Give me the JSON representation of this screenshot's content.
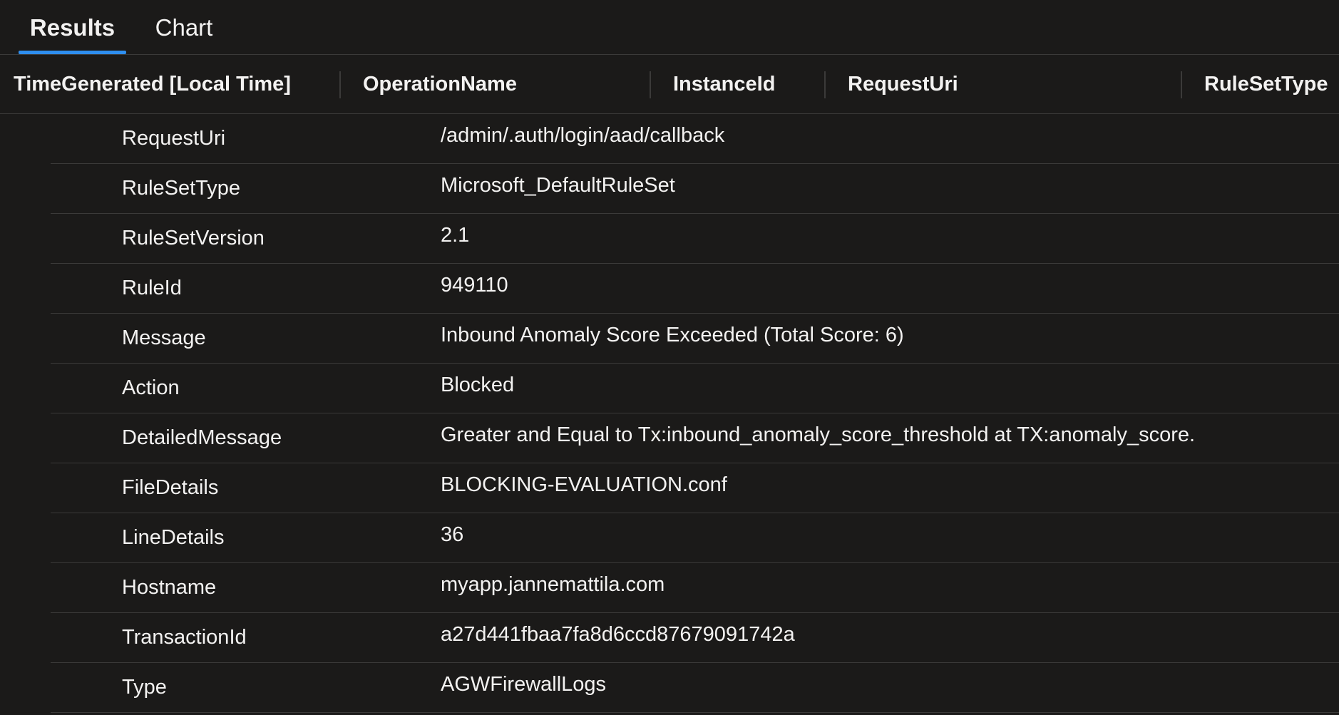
{
  "tabs": [
    {
      "label": "Results"
    },
    {
      "label": "Chart"
    }
  ],
  "columns": [
    {
      "label": "TimeGenerated [Local Time]"
    },
    {
      "label": "OperationName"
    },
    {
      "label": "InstanceId"
    },
    {
      "label": "RequestUri"
    },
    {
      "label": "RuleSetType"
    }
  ],
  "details": [
    {
      "key": "RequestUri",
      "value": "/admin/.auth/login/aad/callback"
    },
    {
      "key": "RuleSetType",
      "value": "Microsoft_DefaultRuleSet"
    },
    {
      "key": "RuleSetVersion",
      "value": "2.1"
    },
    {
      "key": "RuleId",
      "value": "949110"
    },
    {
      "key": "Message",
      "value": "Inbound Anomaly Score Exceeded (Total Score: 6)"
    },
    {
      "key": "Action",
      "value": "Blocked"
    },
    {
      "key": "DetailedMessage",
      "value": "Greater and Equal to Tx:inbound_anomaly_score_threshold at TX:anomaly_score."
    },
    {
      "key": "FileDetails",
      "value": "BLOCKING-EVALUATION.conf"
    },
    {
      "key": "LineDetails",
      "value": "36"
    },
    {
      "key": "Hostname",
      "value": "myapp.jannemattila.com"
    },
    {
      "key": "TransactionId",
      "value": "a27d441fbaa7fa8d6ccd87679091742a"
    },
    {
      "key": "Type",
      "value": "AGWFirewallLogs"
    }
  ],
  "colors": {
    "background": "#1b1a19",
    "text": "#f3f2f1",
    "accent": "#2f8ff0",
    "divider": "#3b3a39"
  }
}
